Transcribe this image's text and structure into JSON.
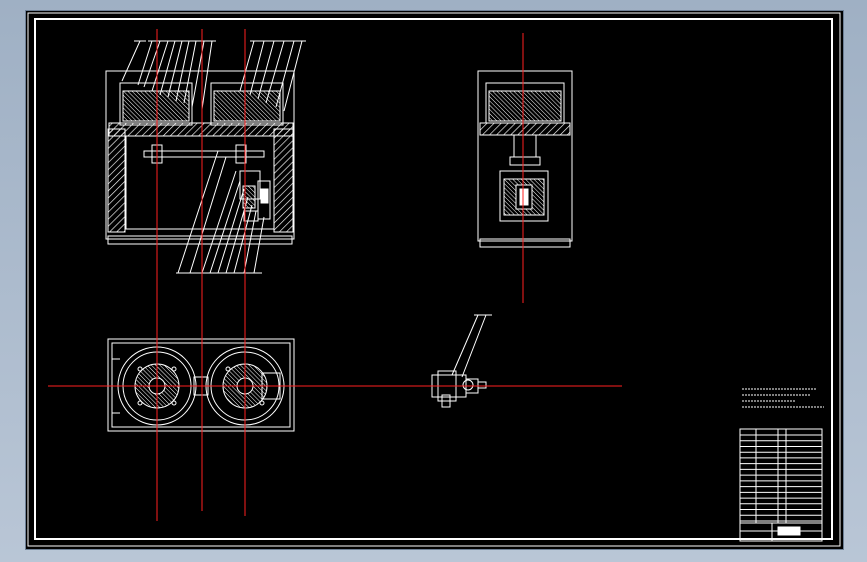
{
  "drawing": {
    "background": "#000000",
    "line_color": "#ffffff",
    "centerline_color": "#ff2020",
    "views": [
      {
        "name": "front-section-view"
      },
      {
        "name": "side-section-view"
      },
      {
        "name": "top-view"
      },
      {
        "name": "detail-view"
      }
    ],
    "technical_notes": {
      "lines": [
        "",
        "",
        ""
      ]
    },
    "title_block": {
      "parts_list_rows": 15,
      "title": "",
      "drawing_number": ""
    }
  }
}
